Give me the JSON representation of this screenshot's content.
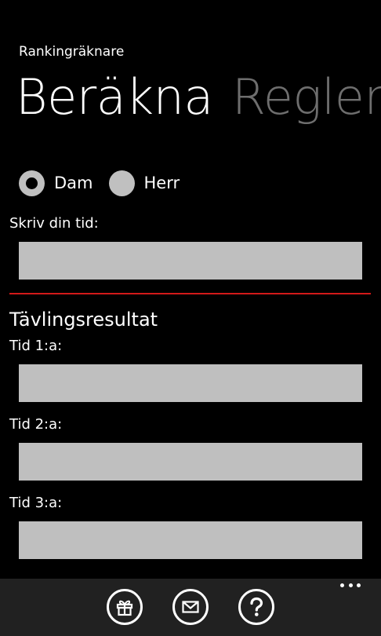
{
  "app": {
    "title": "Rankingräknare"
  },
  "pivot": {
    "tabs": [
      {
        "label": "Beräkna",
        "active": true
      },
      {
        "label": "Regler",
        "active": false
      }
    ]
  },
  "gender": {
    "options": [
      {
        "label": "Dam",
        "checked": true
      },
      {
        "label": "Herr",
        "checked": false
      }
    ]
  },
  "time_input": {
    "label": "Skriv din tid:",
    "value": ""
  },
  "results": {
    "heading": "Tävlingsresultat",
    "fields": [
      {
        "label": "Tid 1:a:",
        "value": ""
      },
      {
        "label": "Tid 2:a:",
        "value": ""
      },
      {
        "label": "Tid 3:a:",
        "value": ""
      }
    ]
  },
  "app_bar": {
    "buttons": [
      {
        "icon": "gift-icon"
      },
      {
        "icon": "mail-icon"
      },
      {
        "icon": "help-icon"
      }
    ]
  },
  "colors": {
    "background": "#000000",
    "accent_divider": "#d21919",
    "input_background": "#bfbfbf",
    "inactive_pivot": "#6e6e6e",
    "app_bar": "#212121"
  }
}
